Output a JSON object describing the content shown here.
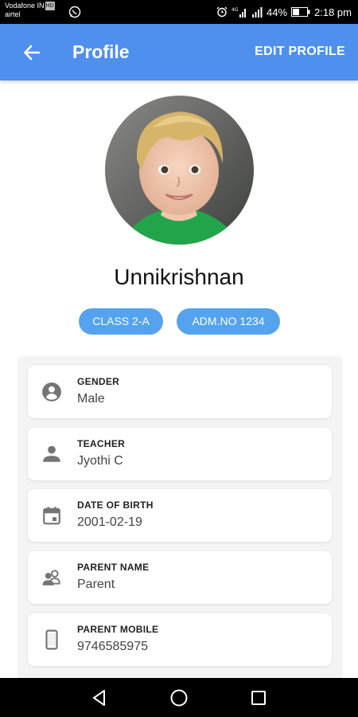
{
  "status_bar": {
    "carrier1": "Vodafone IN",
    "hd": "HD",
    "carrier2": "airtel",
    "battery": "44%",
    "time": "2:18 pm"
  },
  "app_bar": {
    "title": "Profile",
    "edit_label": "EDIT PROFILE",
    "color": "#4f8fee"
  },
  "profile": {
    "name": "Unnikrishnan",
    "class_chip": "CLASS 2-A",
    "adm_chip": "ADM.NO 1234"
  },
  "details": [
    {
      "icon": "account-circle-icon",
      "label": "GENDER",
      "value": "Male"
    },
    {
      "icon": "person-icon",
      "label": "TEACHER",
      "value": "Jyothi C"
    },
    {
      "icon": "calendar-icon",
      "label": "DATE OF BIRTH",
      "value": "2001-02-19"
    },
    {
      "icon": "people-icon",
      "label": "PARENT NAME",
      "value": "Parent"
    },
    {
      "icon": "phone-icon",
      "label": "PARENT MOBILE",
      "value": "9746585975"
    }
  ]
}
